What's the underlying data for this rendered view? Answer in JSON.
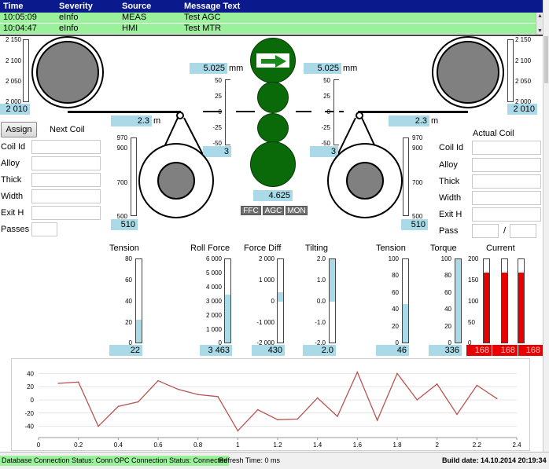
{
  "alarm_table": {
    "headers": {
      "time": "Time",
      "severity": "Severity",
      "source": "Source",
      "message": "Message Text"
    },
    "rows": [
      {
        "time": "10:05:09",
        "severity": "eInfo",
        "source": "MEAS",
        "message": "Test AGC"
      },
      {
        "time": "10:04:47",
        "severity": "eInfo",
        "source": "HMI",
        "message": "Test MTR"
      }
    ]
  },
  "left_reel": {
    "diameter_scale": [
      "2 150",
      "2 100",
      "2 050",
      "2 000"
    ],
    "diameter_value": "2 010",
    "length_value": "2.3",
    "length_unit": "m"
  },
  "right_reel": {
    "diameter_scale": [
      "2 150",
      "2 100",
      "2 050",
      "2 000"
    ],
    "diameter_value": "2 010",
    "length_value": "2.3",
    "length_unit": "m"
  },
  "left_thickness": {
    "value": "5.025",
    "unit": "mm",
    "scale": [
      "50",
      "25",
      "0",
      "-25",
      "-50"
    ],
    "deviation": "3"
  },
  "right_thickness": {
    "value": "5.025",
    "unit": "mm",
    "scale": [
      "50",
      "25",
      "0",
      "-25",
      "-50"
    ],
    "deviation": "3"
  },
  "mill": {
    "gap_value": "4.625",
    "tags": [
      "FFC",
      "AGC",
      "MON"
    ],
    "direction": "right-arrow"
  },
  "left_coil": {
    "scale": [
      "970",
      "900",
      "700",
      "500"
    ],
    "value": "510"
  },
  "right_coil": {
    "scale": [
      "970",
      "900",
      "700",
      "500"
    ],
    "value": "510"
  },
  "next_coil": {
    "assign_label": "Assign",
    "title": "Next Coil",
    "fields": [
      "Coil Id",
      "Alloy",
      "Thick",
      "Width",
      "Exit H",
      "Passes"
    ]
  },
  "actual_coil": {
    "title": "Actual Coil",
    "fields": [
      "Coil Id",
      "Alloy",
      "Thick",
      "Width",
      "Exit H",
      "Pass"
    ],
    "pass_separator": "/"
  },
  "gauges": {
    "tension_left": {
      "title": "Tension",
      "scale": [
        "80",
        "60",
        "40",
        "20",
        "0"
      ],
      "value": "22",
      "fraction": 0.275
    },
    "roll_force": {
      "title": "Roll Force",
      "scale": [
        "6 000",
        "5 000",
        "4 000",
        "3 000",
        "2 000",
        "1 000",
        "0"
      ],
      "value": "3 463",
      "fraction": 0.577
    },
    "force_diff": {
      "title": "Force Diff",
      "scale": [
        "2 000",
        "1 000",
        "0",
        "-1 000",
        "-2 000"
      ],
      "value": "430"
    },
    "tilting": {
      "title": "Tilting",
      "scale": [
        "2.0",
        "1.0",
        "0.0",
        "-1.0",
        "-2.0"
      ],
      "value": "2.0"
    },
    "tension_right": {
      "title": "Tension",
      "scale": [
        "100",
        "80",
        "60",
        "40",
        "20",
        "0"
      ],
      "value": "46",
      "fraction": 0.46
    },
    "torque": {
      "title": "Torque",
      "scale": [
        "100",
        "80",
        "60",
        "40",
        "20",
        "0"
      ],
      "value": "336"
    },
    "current": {
      "title": "Current",
      "scale": [
        "200",
        "150",
        "100",
        "50",
        "0"
      ],
      "values": [
        "168",
        "168",
        "168"
      ],
      "fraction": 0.84
    }
  },
  "trend_chart": {
    "chart_data": {
      "type": "line",
      "x": [
        0.1,
        0.2,
        0.3,
        0.4,
        0.5,
        0.6,
        0.7,
        0.8,
        0.9,
        1.0,
        1.1,
        1.2,
        1.3,
        1.4,
        1.5,
        1.6,
        1.7,
        1.8,
        1.9,
        2.0,
        2.1,
        2.2,
        2.3
      ],
      "y": [
        25,
        27,
        -40,
        -10,
        -3,
        29,
        16,
        8,
        5,
        -47,
        -15,
        -30,
        -29,
        3,
        -25,
        42,
        -31,
        40,
        0,
        24,
        -22,
        22,
        2
      ],
      "xticks": [
        "0",
        "0.2",
        "0.4",
        "0.6",
        "0.8",
        "1",
        "1.2",
        "1.4",
        "1.6",
        "1.8",
        "2",
        "2.2",
        "2.4"
      ],
      "yticks": [
        "40",
        "20",
        "0",
        "-20",
        "-40"
      ],
      "xlim": [
        0,
        2.4
      ],
      "ylim": [
        -50,
        50
      ],
      "color": "#b85450"
    }
  },
  "status_bar": {
    "db_status": "Database Connection Status: Connected",
    "opc_status": "OPC Connection Status: Connected",
    "refresh": "Refresh Time: 0 ms",
    "build": "Build date: 14.10.2014 20:19:34"
  },
  "colors": {
    "alarm_header": "#0a1a8c",
    "alarm_row": "#9bf09b",
    "value_box": "#aadae8",
    "roll_green": "#0a6a0a",
    "current_red": "#e80000"
  }
}
